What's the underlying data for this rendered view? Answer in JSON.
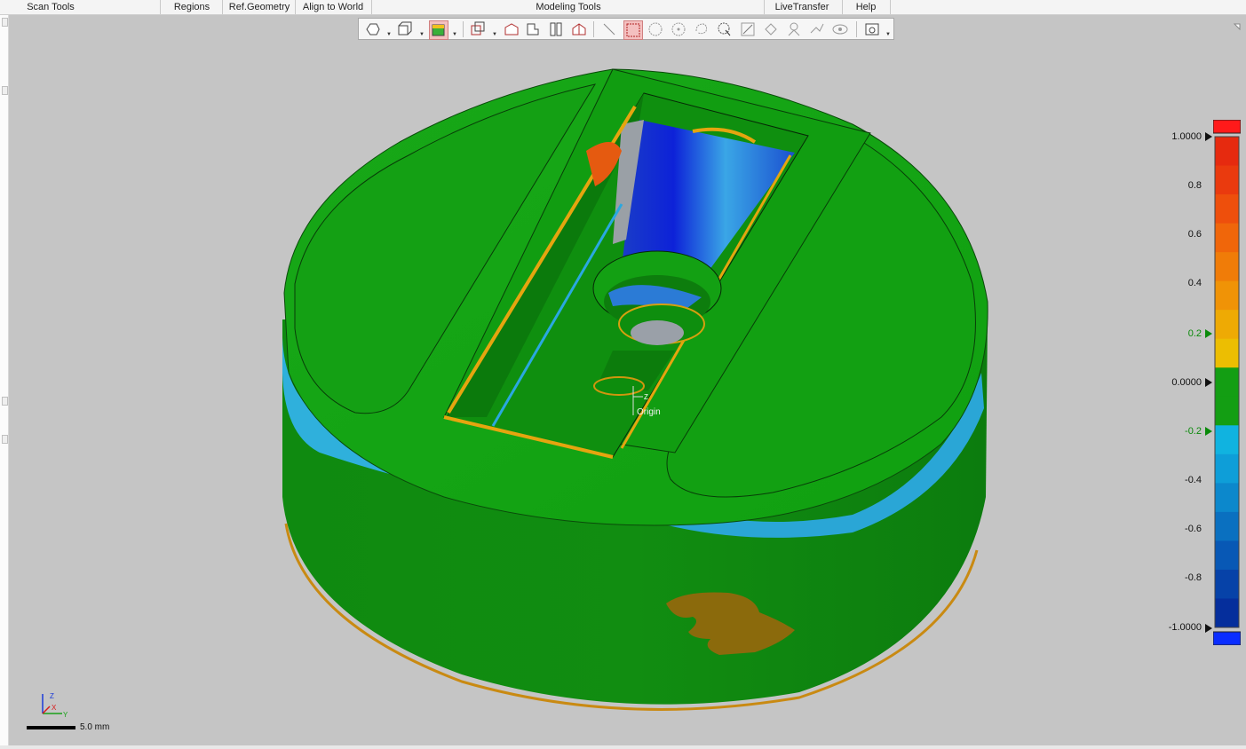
{
  "menubar": {
    "items": [
      "Scan Tools",
      "Regions",
      "Ref.Geometry",
      "Align to World",
      "Modeling Tools",
      "LiveTransfer",
      "Help"
    ]
  },
  "toolbar": {
    "icons": [
      "solid-body-icon",
      "box-view-icon",
      "deviation-color-icon",
      "view-cube-icon",
      "front-view-icon",
      "top-view-icon",
      "side-view-icon",
      "iso-view-icon",
      "line-select-icon",
      "rectangle-select-icon",
      "circle-select-icon",
      "point-select-icon",
      "lasso-select-icon",
      "brush-select-icon",
      "edit-icon",
      "rotate-icon",
      "snap-icon",
      "transfer-icon",
      "visibility-icon",
      "display-options-icon"
    ]
  },
  "legend": {
    "labels": [
      "1.0000",
      "0.8",
      "0.6",
      "0.4",
      "0.2",
      "0.0000",
      "-0.2",
      "-0.4",
      "-0.6",
      "-0.8",
      "-1.0000"
    ],
    "over_color": "#ff1a1a",
    "under_color": "#0a2dff",
    "in_tolerance_color": "#139e13",
    "colors": [
      "#e62a0f",
      "#ea3a0e",
      "#ee4f0c",
      "#f0660a",
      "#f07c08",
      "#f09306",
      "#eeaa04",
      "#ecbe02",
      "#139e13",
      "#139e13",
      "#10b3e0",
      "#0e9ed8",
      "#0c88cc",
      "#0a70c0",
      "#0858b5",
      "#0642a8",
      "#052e9c"
    ]
  },
  "viewport": {
    "origin_label": "Origin",
    "origin_axis_label": "Z",
    "triad_labels": [
      "Z",
      "X",
      "Y"
    ],
    "scale_label": "5.0 mm",
    "background_color": "#c5c5c5"
  }
}
